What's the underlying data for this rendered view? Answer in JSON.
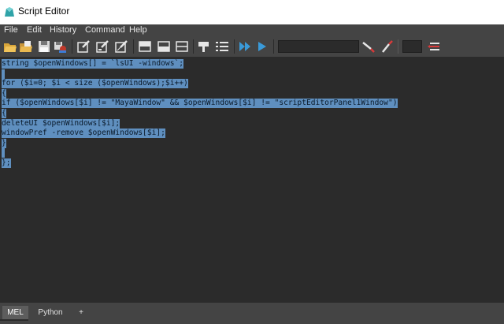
{
  "window": {
    "title": "Script Editor"
  },
  "menu": [
    "File",
    "Edit",
    "History",
    "Command",
    "Help"
  ],
  "toolbar": {
    "icons": [
      "open-script-icon",
      "source-script-icon",
      "save-script-icon",
      "save-to-shelf-icon",
      "echo-all-commands-icon",
      "show-line-numbers-icon",
      "clear-history-icon",
      "show-history-icon",
      "show-input-icon",
      "show-both-icon",
      "go-to-line-icon",
      "line-numbers-list-icon",
      "execute-all-icon",
      "execute-icon",
      "search-down-icon",
      "search-up-icon",
      "clear-search-icon"
    ],
    "search_value": "",
    "line_value": ""
  },
  "editor": {
    "lines": [
      "string $openWindows[] = `lsUI -windows`;",
      "",
      "for ($i=0; $i < size ($openWindows);$i++)",
      "{",
      "if ($openWindows[$i] != \"MayaWindow\" && $openWindows[$i] != \"scriptEditorPanel1Window\")",
      "{",
      "deleteUI $openWindows[$i];",
      "windowPref -remove $openWindows[$i];",
      "}",
      "",
      "};"
    ]
  },
  "tabs": [
    "MEL",
    "Python",
    "+"
  ],
  "colors": {
    "selection": "#5f8fbf",
    "background": "#2b2b2b",
    "chrome": "#444444"
  }
}
